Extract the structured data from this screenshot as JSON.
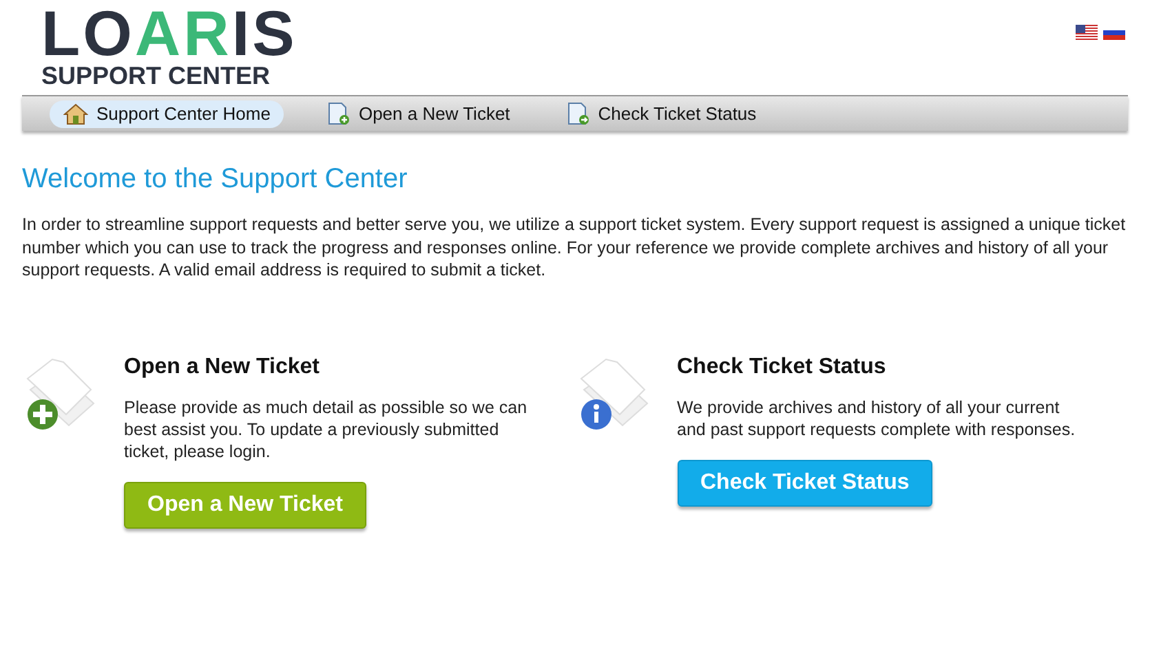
{
  "logo": {
    "wordmark": "LOARIS",
    "subtitle": "SUPPORT CENTER"
  },
  "languages": [
    {
      "kind": "us"
    },
    {
      "kind": "ru"
    }
  ],
  "nav": [
    {
      "label": "Support Center Home",
      "kind": "home",
      "selected": true
    },
    {
      "label": "Open a New Ticket",
      "kind": "new",
      "selected": false
    },
    {
      "label": "Check Ticket Status",
      "kind": "status",
      "selected": false
    }
  ],
  "heading": "Welcome to the Support Center",
  "intro": "In order to streamline support requests and better serve you, we utilize a support ticket system. Every support request is assigned a unique ticket number which you can use to track the progress and responses online. For your reference we provide complete archives and history of all your support requests. A valid email address is required to submit a ticket.",
  "sections": [
    {
      "kind": "new",
      "title": "Open a New Ticket",
      "text": "Please provide as much detail as possible so we can best assist you. To update a previously submitted ticket, please login.",
      "button": "Open a New Ticket"
    },
    {
      "kind": "status",
      "title": "Check Ticket Status",
      "text": "We provide archives and history of all your current and past support requests complete with responses.",
      "button": "Check Ticket Status"
    }
  ]
}
